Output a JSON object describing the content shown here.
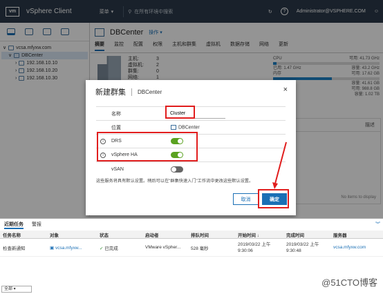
{
  "topbar": {
    "logo": "vm",
    "title": "vSphere Client",
    "menu_label": "菜单",
    "search_placeholder": "在所有环境中搜索",
    "help_label": "?",
    "user": "Administrator@VSPHERE.COM",
    "smiley": "☺"
  },
  "tree": {
    "vcsa": "vcsa.mfyxw.com",
    "datacenter": "DBCenter",
    "hosts": [
      "192.168.10.10",
      "192.168.10.20",
      "192.168.10.30"
    ]
  },
  "main": {
    "title": "DBCenter",
    "actions": "操作 ▾",
    "tabs": [
      "摘要",
      "监控",
      "配置",
      "权限",
      "主机和群集",
      "虚拟机",
      "数据存储",
      "网络",
      "更新"
    ],
    "stats": [
      {
        "label": "主机:",
        "value": "3"
      },
      {
        "label": "虚拟机:",
        "value": "2"
      },
      {
        "label": "群集:",
        "value": "0"
      },
      {
        "label": "网络:",
        "value": "1"
      }
    ],
    "resources": {
      "cpu_label": "CPU",
      "cpu_free": "可用: 41.73 GHz",
      "cpu_used": "已用: 1.47 GHz",
      "cpu_cap": "容量: 43.2 GHz",
      "cpu_pct": 3,
      "mem_label": "内存",
      "mem_free": "可用: 17.62 GB",
      "mem_pct": 55,
      "storage_cap": "容量: 41.61 GB",
      "storage_free": "可用: 988.8 GB",
      "storage_used": "容量: 1.02 TB"
    },
    "right_hdr_col1": "",
    "right_hdr_col2": "描述",
    "no_items": "No items to display"
  },
  "modal": {
    "title": "新建群集",
    "subtitle": "DBCenter",
    "close": "×",
    "name_label": "名称",
    "name_value": "Cluster",
    "location_label": "位置",
    "location_value": "DBCenter",
    "drs_label": "DRS",
    "drs_on": true,
    "ha_label": "vSphere HA",
    "ha_on": true,
    "vsan_label": "vSAN",
    "vsan_on": false,
    "note": "这些服务将具有默认设置。稍后可以在\"群集快速入门\"工作流中更改这些默认设置。",
    "cancel": "取消",
    "ok": "确定"
  },
  "tasks": {
    "tabs": [
      "近期任务",
      "警报"
    ],
    "columns": [
      "任务名称",
      "对象",
      "状态",
      "启动者",
      "排队时间",
      "开始时间 ↓",
      "完成时间",
      "服务器"
    ],
    "rows": [
      {
        "name": "检查新通知",
        "object": "vcsa.mfyxw...",
        "status": "已完成",
        "initiator": "VMware vSpher...",
        "queue": "528 毫秒",
        "start": "2019/03/22 上午 9:30:06",
        "end": "2019/03/22 上午 9:30:48",
        "server": "vcsa.mfyxw.com"
      }
    ],
    "filter": "全部",
    "expand": "︾"
  },
  "watermark": "@51CTO博客",
  "colors": {
    "accent": "#1a6fb5",
    "topbar": "#2b3a4a",
    "toggle_on": "#5aa220",
    "highlight": "#e11d1d"
  }
}
